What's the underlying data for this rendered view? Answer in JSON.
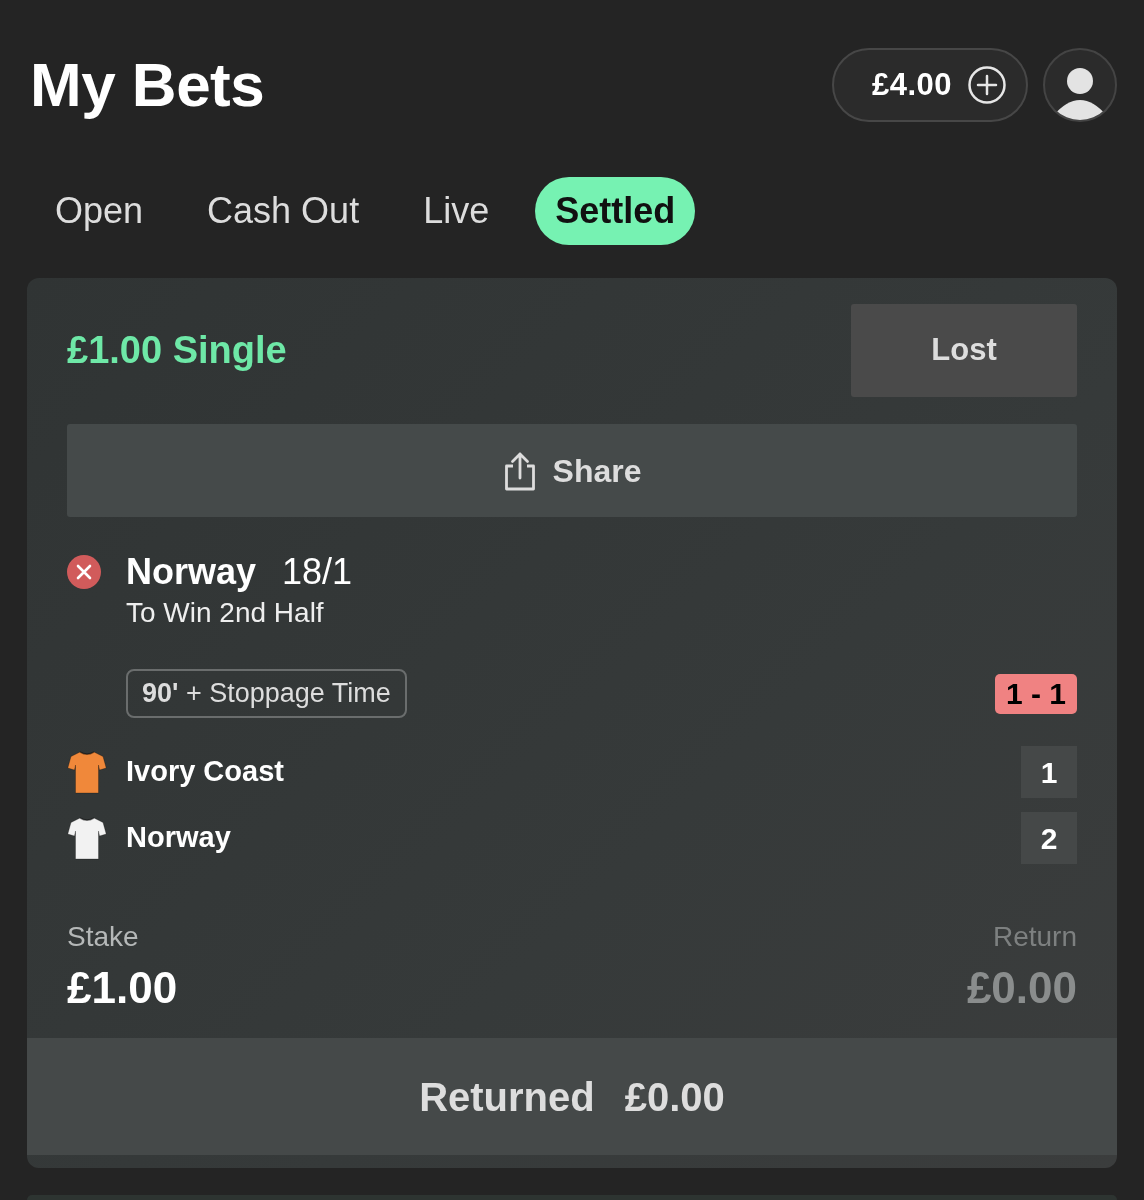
{
  "header": {
    "title": "My Bets",
    "balance": "£4.00"
  },
  "tabs": [
    {
      "label": "Open",
      "selected": false
    },
    {
      "label": "Cash Out",
      "selected": false
    },
    {
      "label": "Live",
      "selected": false
    },
    {
      "label": "Settled",
      "selected": true
    }
  ],
  "bets": [
    {
      "title": "£1.00 Single",
      "status": "Lost",
      "share_button": "Share",
      "selections": [
        {
          "lost": true,
          "team": "Norway",
          "odds": "18/1",
          "market": "To Win 2nd Half",
          "period": "**90'** + Stoppage Time",
          "score": "1 - 1",
          "teams": [
            {
              "name": "Ivory Coast",
              "score": "1",
              "color": "#f0883a"
            },
            {
              "name": "Norway",
              "score": "2",
              "color": "#f2f2f2"
            }
          ]
        }
      ],
      "stake": {
        "label": "Stake",
        "value": "£1.00"
      },
      "return": {
        "label": "Return",
        "value": "£0.00"
      },
      "returned": {
        "label": "Returned",
        "value": "£0.00"
      }
    }
  ]
}
